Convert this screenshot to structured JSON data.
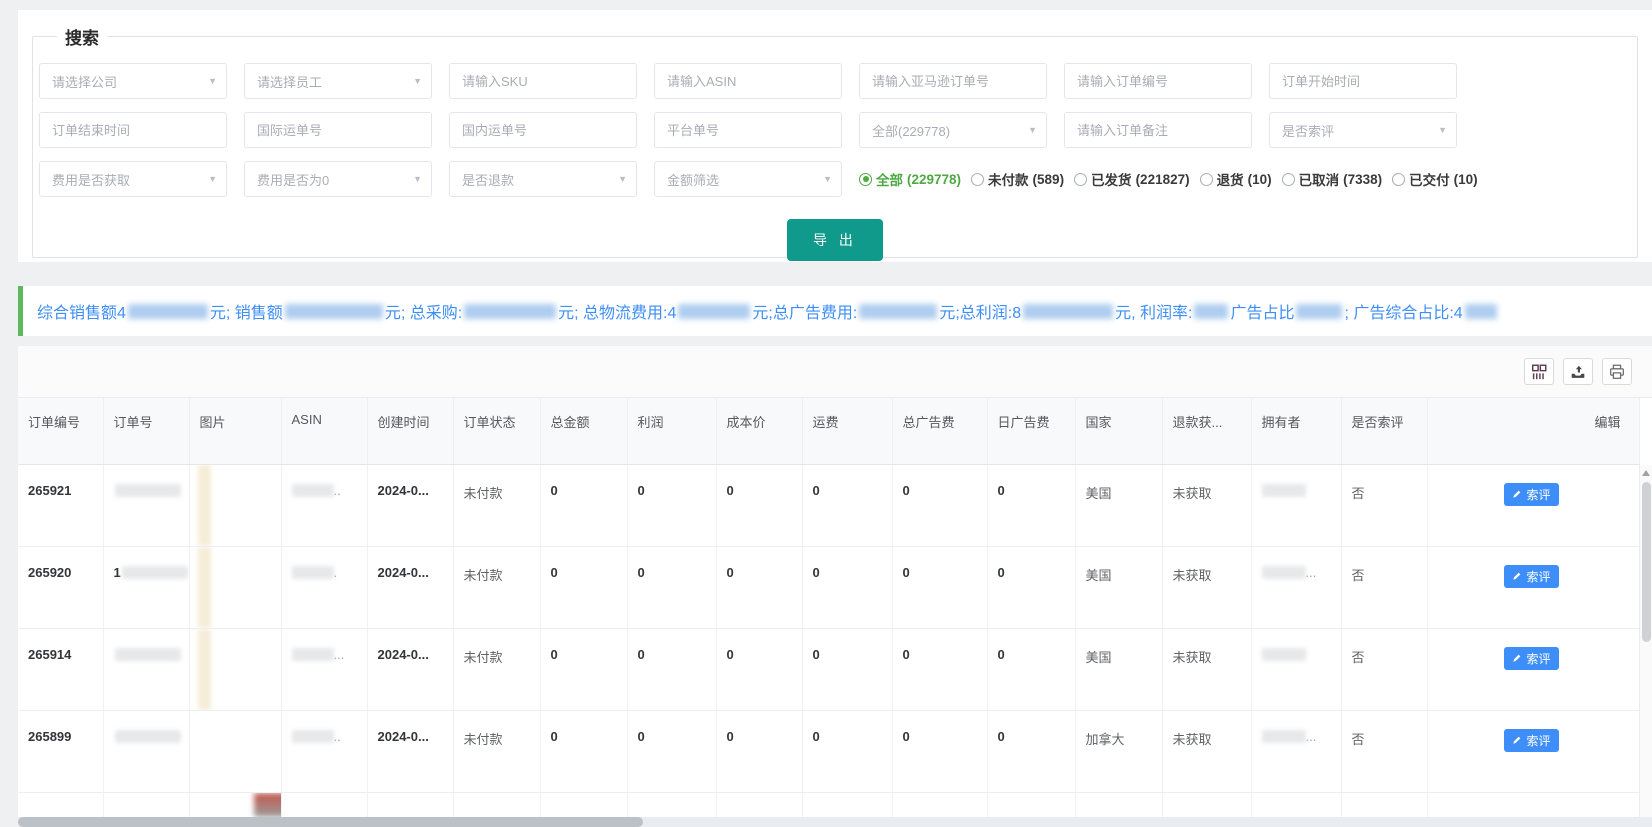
{
  "search": {
    "legend": "搜索",
    "fields": {
      "company": "请选择公司",
      "employee": "请选择员工",
      "sku": "请输入SKU",
      "asin": "请输入ASIN",
      "amazon_order": "请输入亚马逊订单号",
      "order_no": "请输入订单编号",
      "order_start": "订单开始时间",
      "order_end": "订单结束时间",
      "intl_tracking": "国际运单号",
      "domestic_tracking": "国内运单号",
      "platform_order": "平台单号",
      "status_all": "全部(229778)",
      "order_note": "请输入订单备注",
      "review_request": "是否索评",
      "fee_fetched": "费用是否获取",
      "fee_zero": "费用是否为0",
      "refund": "是否退款",
      "amount_filter": "金额筛选"
    },
    "radios": [
      {
        "label": "全部",
        "count": "(229778)",
        "selected": true
      },
      {
        "label": "未付款",
        "count": "(589)",
        "selected": false
      },
      {
        "label": "已发货",
        "count": "(221827)",
        "selected": false
      },
      {
        "label": "退货",
        "count": "(10)",
        "selected": false
      },
      {
        "label": "已取消",
        "count": "(7338)",
        "selected": false
      },
      {
        "label": "已交付",
        "count": "(10)",
        "selected": false
      }
    ],
    "export_label": "导 出"
  },
  "summary": {
    "segments": [
      "综合销售额4",
      "元; 销售额",
      "元; 总采购:",
      "元; 总物流费用:4",
      "元;总广告费用:",
      "元;总利润:8",
      "元, 利润率:",
      " 广告占比",
      " ; 广告综合占比:4"
    ]
  },
  "toolbar": {
    "icons": [
      "column-settings-icon",
      "export-icon",
      "printer-icon"
    ]
  },
  "table": {
    "headers": [
      "订单编号",
      "订单号",
      "图片",
      "ASIN",
      "创建时间",
      "订单状态",
      "总金额",
      "利润",
      "成本价",
      "运费",
      "总广告费",
      "日广告费",
      "国家",
      "退款获...",
      "拥有者",
      "是否索评",
      "编辑"
    ],
    "rows": [
      {
        "order_id": "265921",
        "sn_prefix": "",
        "asin_suffix": "..",
        "created": "2024-0...",
        "status": "未付款",
        "total": "0",
        "profit": "0",
        "cost": "0",
        "freight": "0",
        "ad_total": "0",
        "ad_daily": "0",
        "country": "美国",
        "refund": "未获取",
        "owner_suffix": "",
        "review": "否",
        "edit": "索评"
      },
      {
        "order_id": "265920",
        "sn_prefix": "1",
        "asin_suffix": ".",
        "created": "2024-0...",
        "status": "未付款",
        "total": "0",
        "profit": "0",
        "cost": "0",
        "freight": "0",
        "ad_total": "0",
        "ad_daily": "0",
        "country": "美国",
        "refund": "未获取",
        "owner_suffix": "...",
        "review": "否",
        "edit": "索评"
      },
      {
        "order_id": "265914",
        "sn_prefix": "",
        "asin_suffix": "...",
        "created": "2024-0...",
        "status": "未付款",
        "total": "0",
        "profit": "0",
        "cost": "0",
        "freight": "0",
        "ad_total": "0",
        "ad_daily": "0",
        "country": "美国",
        "refund": "未获取",
        "owner_suffix": "",
        "review": "否",
        "edit": "索评"
      },
      {
        "order_id": "265899",
        "sn_prefix": "",
        "asin_suffix": "..",
        "created": "2024-0...",
        "status": "未付款",
        "total": "0",
        "profit": "0",
        "cost": "0",
        "freight": "0",
        "ad_total": "0",
        "ad_daily": "0",
        "country": "加拿大",
        "refund": "未获取",
        "owner_suffix": "...",
        "review": "否",
        "edit": "索评"
      }
    ]
  }
}
